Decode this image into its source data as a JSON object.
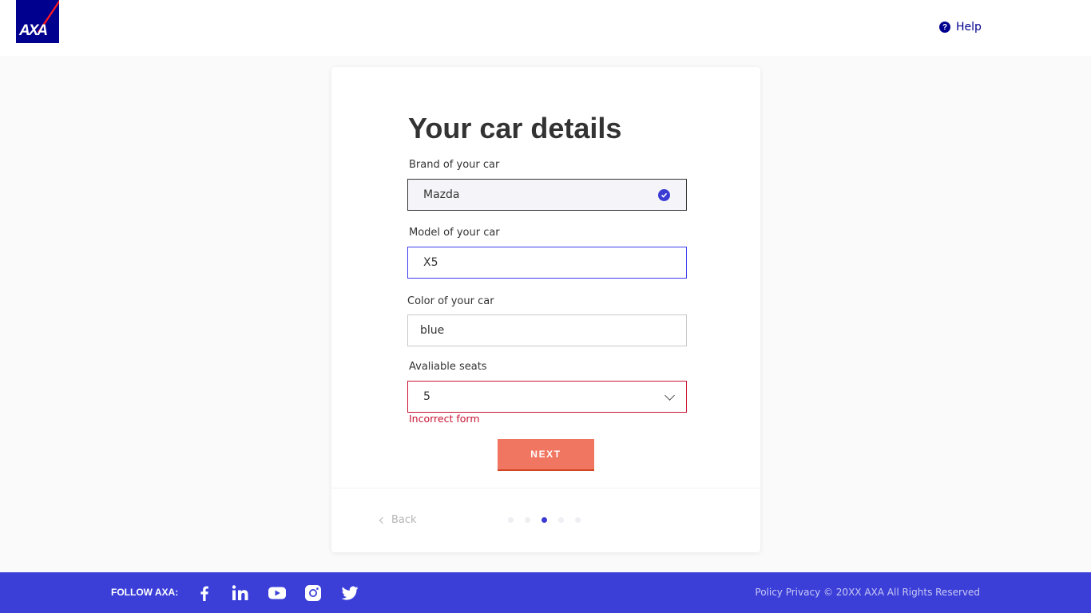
{
  "header": {
    "logo_text": "AXA",
    "help_label": "Help"
  },
  "form": {
    "title": "Your car details",
    "brand": {
      "label": "Brand of your car",
      "value": "Mazda"
    },
    "model": {
      "label": "Model of your car",
      "value": "X5"
    },
    "color": {
      "label": "Color of your car",
      "value": "blue"
    },
    "seats": {
      "label": "Avaliable seats",
      "value": "5",
      "error": "Incorrect form"
    },
    "next_label": "NEXT",
    "back_label": "Back",
    "steps_total": 5,
    "step_current": 3
  },
  "footer": {
    "follow_label": "FOLLOW AXA:",
    "social": [
      "facebook-icon",
      "linkedin-icon",
      "youtube-icon",
      "instagram-icon",
      "twitter-icon"
    ],
    "copyright": "Policy Privacy  © 20XX AXA All Rights Reserved"
  },
  "colors": {
    "brand_blue": "#00008f",
    "accent": "#3b3bd4",
    "button": "#f07662",
    "error": "#c91432",
    "footer": "#3b3fd8"
  }
}
